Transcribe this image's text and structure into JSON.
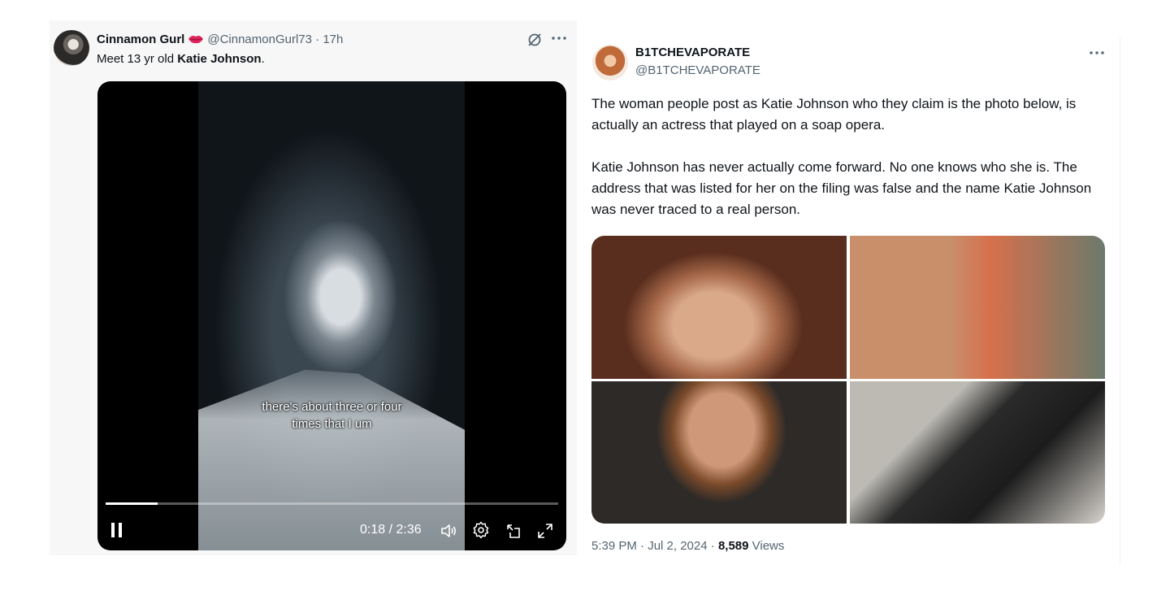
{
  "left_tweet": {
    "display_name": "Cinnamon Gurl",
    "handle": "@CinnamonGurl73",
    "separator": "·",
    "time_ago": "17h",
    "text_prefix": "Meet 13 yr old ",
    "text_bold": "Katie Johnson",
    "text_suffix": ".",
    "icons": [
      "lips-emoji-icon",
      "grok-icon",
      "more-icon"
    ],
    "video": {
      "caption_line1": "there's about three or four",
      "caption_line2": "times that I um",
      "time_display": "0:18 / 2:36",
      "progress": 0.115,
      "icons": [
        "pause-icon",
        "volume-icon",
        "settings-icon",
        "picture-in-picture-icon",
        "fullscreen-icon"
      ]
    }
  },
  "right_tweet": {
    "display_name": "B1TCHEVAPORATE",
    "handle": "@B1TCHEVAPORATE",
    "paragraph1": "The woman people post as Katie Johnson who they claim is the photo below, is actually an actress that played on a soap opera.",
    "paragraph2": "Katie Johnson has never actually come forward. No one knows who she is. The address that was listed for her on the filing was false and the name Katie Johnson was never traced to a real person.",
    "timestamp": "5:39 PM · Jul 2, 2024",
    "meta_separator": " · ",
    "views_count": "8,589",
    "views_label": " Views",
    "icons": [
      "more-icon"
    ]
  },
  "colors": {
    "text_primary": "#0f1419",
    "text_secondary": "#536471",
    "left_background": "#f7f7f7",
    "lips": "#e0245e"
  }
}
